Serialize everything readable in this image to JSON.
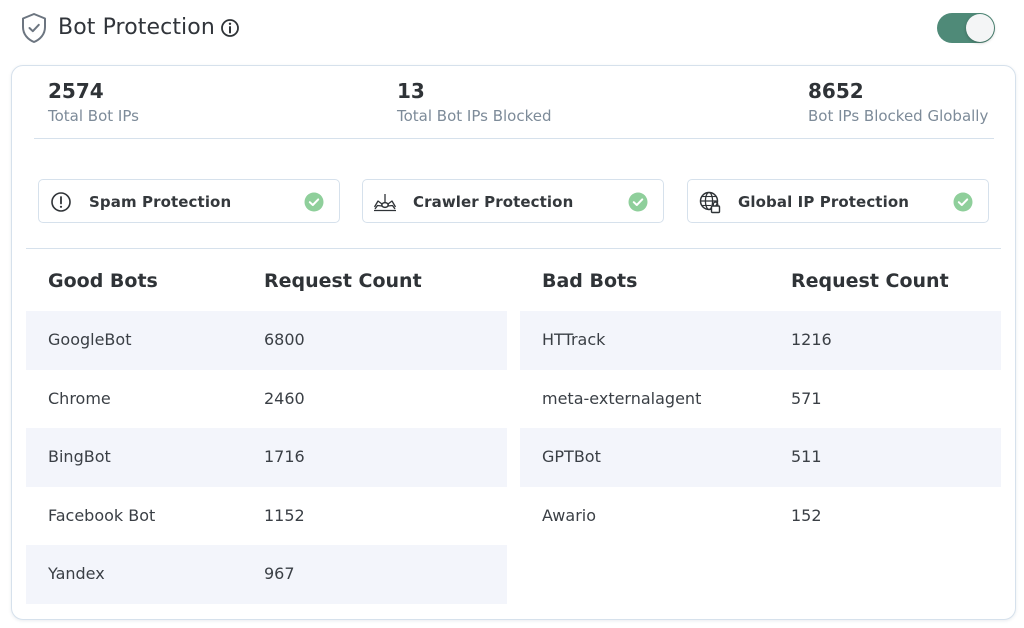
{
  "header": {
    "title": "Bot Protection",
    "toggle_on": true,
    "accent": "#4f8a78"
  },
  "stats": [
    {
      "value": "2574",
      "label": "Total Bot IPs"
    },
    {
      "value": "13",
      "label": "Total Bot IPs Blocked"
    },
    {
      "value": "8652",
      "label": "Bot IPs Blocked Globally"
    }
  ],
  "features": [
    {
      "label": "Spam Protection",
      "icon": "alert-circle-icon",
      "enabled": true
    },
    {
      "label": "Crawler Protection",
      "icon": "spider-icon",
      "enabled": true
    },
    {
      "label": "Global IP Protection",
      "icon": "globe-lock-icon",
      "enabled": true
    }
  ],
  "good_bots": {
    "headers": [
      "Good Bots",
      "Request Count"
    ],
    "rows": [
      [
        "GoogleBot",
        "6800"
      ],
      [
        "Chrome",
        "2460"
      ],
      [
        "BingBot",
        "1716"
      ],
      [
        "Facebook Bot",
        "1152"
      ],
      [
        "Yandex",
        "967"
      ]
    ]
  },
  "bad_bots": {
    "headers": [
      "Bad Bots",
      "Request Count"
    ],
    "rows": [
      [
        "HTTrack",
        "1216"
      ],
      [
        "meta-externalagent",
        "571"
      ],
      [
        "GPTBot",
        "511"
      ],
      [
        "Awario",
        "152"
      ]
    ]
  },
  "colors": {
    "check_green": "#8fcf9b",
    "row_shade": "#f3f5fb",
    "border": "#d6e1ec"
  }
}
